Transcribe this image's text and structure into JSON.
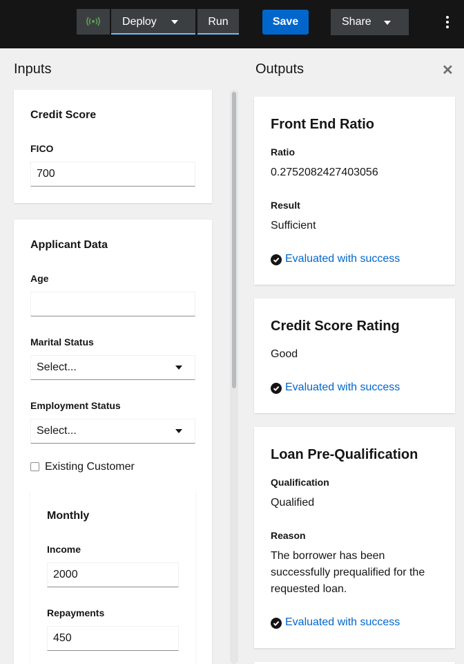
{
  "toolbar": {
    "deploy_label": "Deploy",
    "run_label": "Run",
    "save_label": "Save",
    "share_label": "Share"
  },
  "inputs": {
    "title": "Inputs",
    "credit_score": {
      "title": "Credit Score",
      "fico_label": "FICO",
      "fico_value": "700"
    },
    "applicant": {
      "title": "Applicant Data",
      "age_label": "Age",
      "age_value": "",
      "marital_label": "Marital Status",
      "marital_value": "Select...",
      "employment_label": "Employment Status",
      "employment_value": "Select...",
      "existing_customer_label": "Existing Customer",
      "existing_customer_checked": false,
      "monthly": {
        "title": "Monthly",
        "income_label": "Income",
        "income_value": "2000",
        "repayments_label": "Repayments",
        "repayments_value": "450"
      }
    }
  },
  "outputs": {
    "title": "Outputs",
    "front_end_ratio": {
      "title": "Front End Ratio",
      "ratio_label": "Ratio",
      "ratio_value": "0.2752082427403056",
      "result_label": "Result",
      "result_value": "Sufficient",
      "status": "Evaluated with success"
    },
    "credit_score_rating": {
      "title": "Credit Score Rating",
      "value": "Good",
      "status": "Evaluated with success"
    },
    "loan_prequal": {
      "title": "Loan Pre-Qualification",
      "qualification_label": "Qualification",
      "qualification_value": "Qualified",
      "reason_label": "Reason",
      "reason_value": "The borrower has been successfully prequalified for the requested loan.",
      "status": "Evaluated with success"
    }
  },
  "colors": {
    "toolbar_bg": "#151515",
    "primary": "#0066cc",
    "status_green": "#5ba352"
  },
  "icons": [
    "broadcast-icon",
    "caret-down-icon",
    "kebab-icon",
    "close-icon",
    "check-circle-icon",
    "select-arrow-icon"
  ]
}
